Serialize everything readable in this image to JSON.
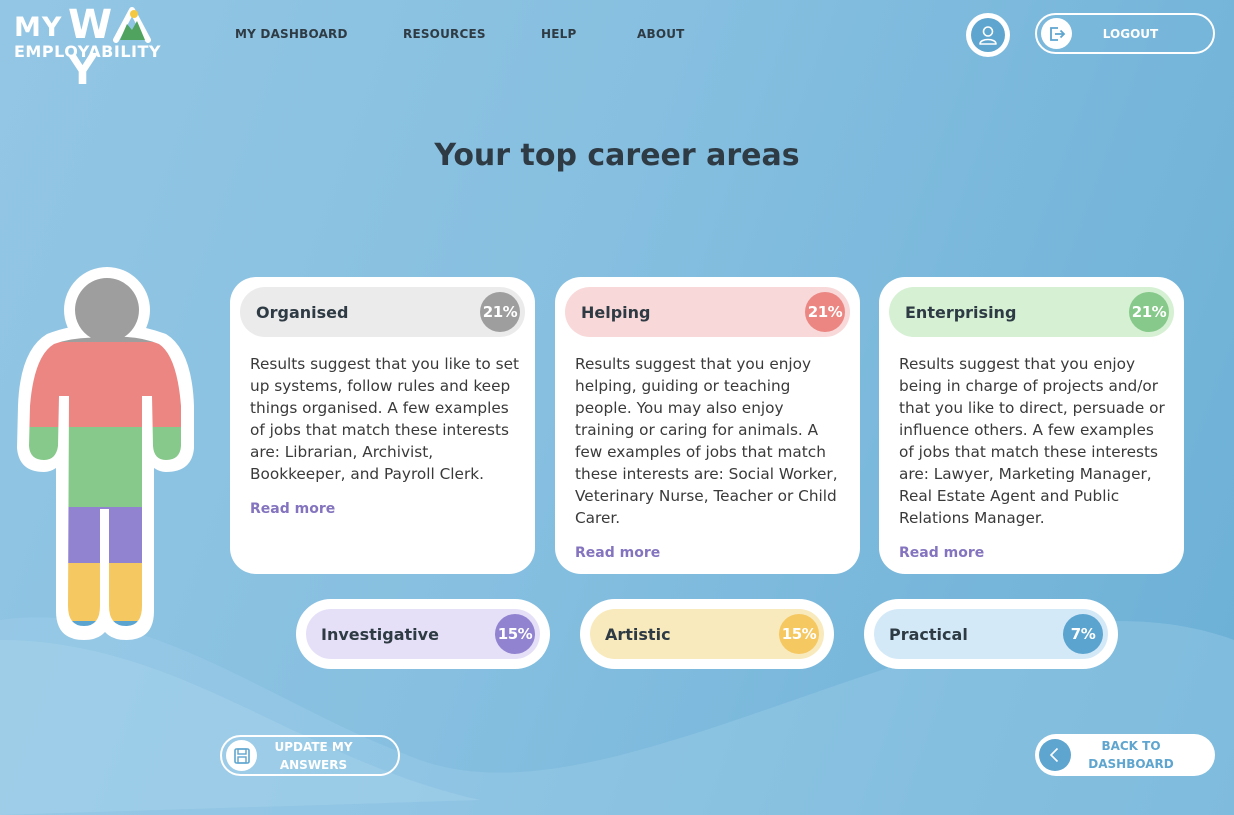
{
  "brand": {
    "line1_a": "MY",
    "line1_b": "W",
    "line1_c": "Y",
    "line2": "EMPLOYABILITY"
  },
  "nav": [
    {
      "label": "MY DASHBOARD"
    },
    {
      "label": "RESOURCES"
    },
    {
      "label": "HELP"
    },
    {
      "label": "ABOUT"
    }
  ],
  "header": {
    "logout_label": "LOGOUT",
    "profile_icon": "user-icon",
    "logout_icon": "logout-icon"
  },
  "page": {
    "title": "Your top career areas"
  },
  "top_areas": [
    {
      "name": "Organised",
      "percent": "21%",
      "value": 21,
      "header_bg": "#ebebeb",
      "badge_color": "#9e9e9e",
      "description": "Results suggest that you like to set up systems, follow rules and keep things organised. A few examples of jobs that match these interests are: Librarian, Archivist, Bookkeeper, and Payroll Clerk.",
      "link": "Read more"
    },
    {
      "name": "Helping",
      "percent": "21%",
      "value": 21,
      "header_bg": "#f8d8d8",
      "badge_color": "#eb8682",
      "description": "Results suggest that you enjoy helping, guiding or teaching people. You may also enjoy training or caring for animals. A few examples of jobs that match these interests are: Social Worker, Veterinary Nurse, Teacher or Child Carer.",
      "link": "Read more"
    },
    {
      "name": "Enterprising",
      "percent": "21%",
      "value": 21,
      "header_bg": "#d5f0d3",
      "badge_color": "#86c98a",
      "description": "Results suggest that you enjoy being in charge of projects and/or that you like to direct, persuade or influence others. A few examples of jobs that match these interests are: Lawyer, Marketing Manager, Real Estate Agent and Public Relations Manager.",
      "link": "Read more"
    }
  ],
  "other_areas": [
    {
      "name": "Investigative",
      "percent": "15%",
      "value": 15,
      "bg": "#e5e0f7",
      "badge_color": "#9183d0"
    },
    {
      "name": "Artistic",
      "percent": "15%",
      "value": 15,
      "bg": "#f8eabd",
      "badge_color": "#f5c862"
    },
    {
      "name": "Practical",
      "percent": "7%",
      "value": 7,
      "bg": "#d4e9f7",
      "badge_color": "#5ba4d0"
    }
  ],
  "figure_colors": {
    "head": "#9e9e9e",
    "torso": "#eb8682",
    "waist": "#86c98a",
    "thighs": "#9183d0",
    "shins": "#f5c862",
    "feet": "#5ba4d0"
  },
  "footer": {
    "update_label_1": "UPDATE MY",
    "update_label_2": "ANSWERS",
    "back_label_1": "BACK TO",
    "back_label_2": "DASHBOARD"
  }
}
